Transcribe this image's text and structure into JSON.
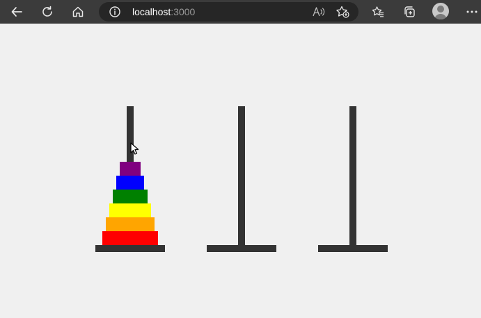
{
  "browser": {
    "url_host": "localhost",
    "url_port": ":3000",
    "icons": [
      "back-icon",
      "refresh-icon",
      "home-icon",
      "info-icon",
      "read-aloud-icon",
      "add-favorite-icon",
      "favorites-icon",
      "collections-icon",
      "profile-icon",
      "more-icon"
    ]
  },
  "game": {
    "colors": {
      "pole": "#333333",
      "background": "#f0f0f0",
      "disks": [
        "#800080",
        "#0000ff",
        "#008000",
        "#ffff00",
        "#ffa500",
        "#ff0000"
      ]
    },
    "towers": [
      {
        "disks": [
          1,
          2,
          3,
          4,
          5,
          6
        ]
      },
      {
        "disks": []
      },
      {
        "disks": []
      }
    ]
  }
}
